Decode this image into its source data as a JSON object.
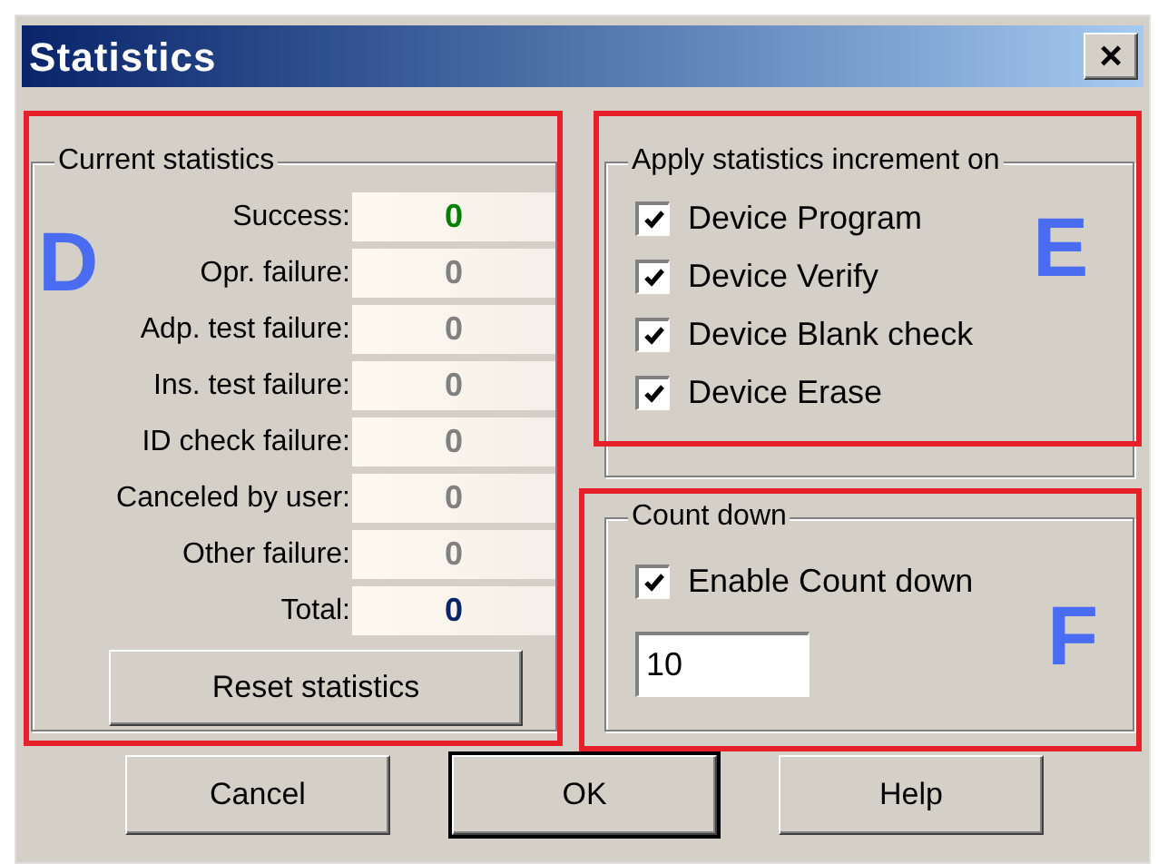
{
  "window": {
    "title": "Statistics",
    "close": "×"
  },
  "current_statistics": {
    "title": "Current statistics",
    "rows": [
      {
        "label": "Success:",
        "value": "0",
        "color": "#008000"
      },
      {
        "label": "Opr. failure:",
        "value": "0",
        "color": "#808080"
      },
      {
        "label": "Adp. test failure:",
        "value": "0",
        "color": "#808080"
      },
      {
        "label": "Ins. test failure:",
        "value": "0",
        "color": "#808080"
      },
      {
        "label": "ID check failure:",
        "value": "0",
        "color": "#808080"
      },
      {
        "label": "Canceled by user:",
        "value": "0",
        "color": "#808080"
      },
      {
        "label": "Other failure:",
        "value": "0",
        "color": "#808080"
      },
      {
        "label": "Total:",
        "value": "0",
        "color": "#0a246a"
      }
    ],
    "reset_button": "Reset statistics"
  },
  "apply_increment": {
    "title": "Apply statistics increment on",
    "options": [
      {
        "label": "Device Program",
        "checked": true
      },
      {
        "label": "Device Verify",
        "checked": true
      },
      {
        "label": "Device Blank check",
        "checked": true
      },
      {
        "label": "Device Erase",
        "checked": true
      }
    ]
  },
  "count_down": {
    "title": "Count down",
    "enable": {
      "label": "Enable Count down",
      "checked": true
    },
    "value": "10"
  },
  "buttons": [
    {
      "label": "Cancel",
      "default": false
    },
    {
      "label": "OK",
      "default": true
    },
    {
      "label": "Help",
      "default": false
    }
  ],
  "annotations": [
    {
      "letter": "D"
    },
    {
      "letter": "E"
    },
    {
      "letter": "F"
    }
  ]
}
